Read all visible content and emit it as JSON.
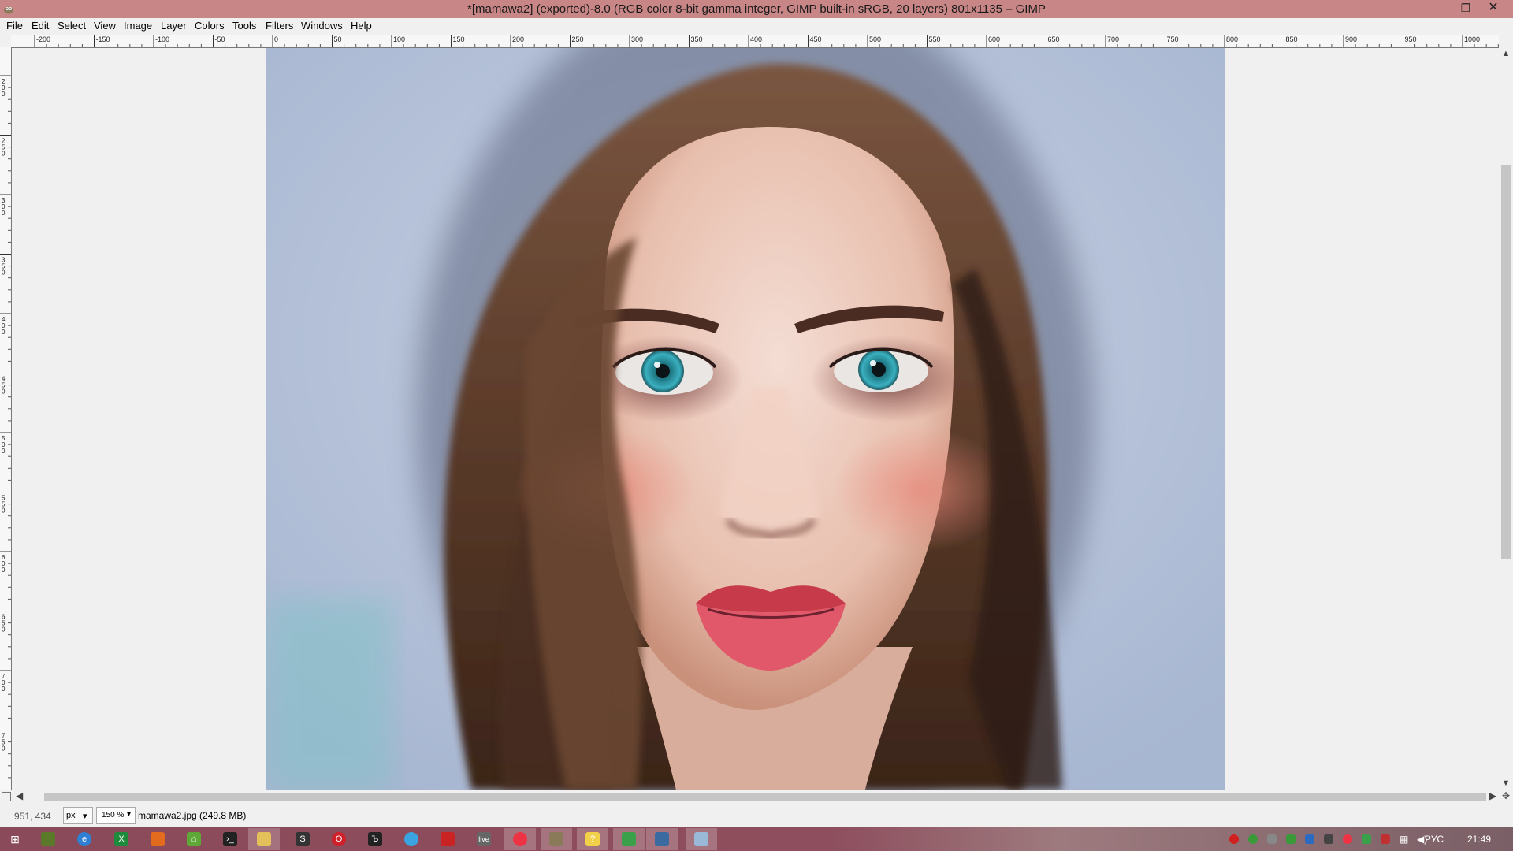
{
  "window": {
    "title": "*[mamawa2] (exported)-8.0 (RGB color 8-bit gamma integer, GIMP built-in sRGB, 20 layers) 801x1135 – GIMP",
    "minimize": "–",
    "maximize": "❐",
    "close": "✕"
  },
  "menu": [
    "File",
    "Edit",
    "Select",
    "View",
    "Image",
    "Layer",
    "Colors",
    "Tools",
    "Filters",
    "Windows",
    "Help"
  ],
  "ruler": {
    "top_labels": [
      "-200",
      "-150",
      "-100",
      "-50",
      "0",
      "50",
      "100",
      "150",
      "200",
      "250",
      "300",
      "350",
      "400",
      "450",
      "500",
      "550",
      "600",
      "650",
      "700",
      "750",
      "800",
      "850",
      "900",
      "950",
      "1000"
    ],
    "left_labels": [
      "200",
      "250",
      "300",
      "350",
      "400",
      "450",
      "500",
      "550",
      "600",
      "650",
      "700",
      "750"
    ]
  },
  "status": {
    "pointer_coords": "951, 434",
    "unit": "px",
    "zoom": "150 %",
    "file_info": "mamawa2.jpg (249.8 MB)"
  },
  "taskbar": {
    "language": "РУС",
    "time": "21:49"
  },
  "colors": {
    "titlebar": "#c98686",
    "canvas_background": "#aab8d2",
    "guide": "#6e7a28"
  }
}
